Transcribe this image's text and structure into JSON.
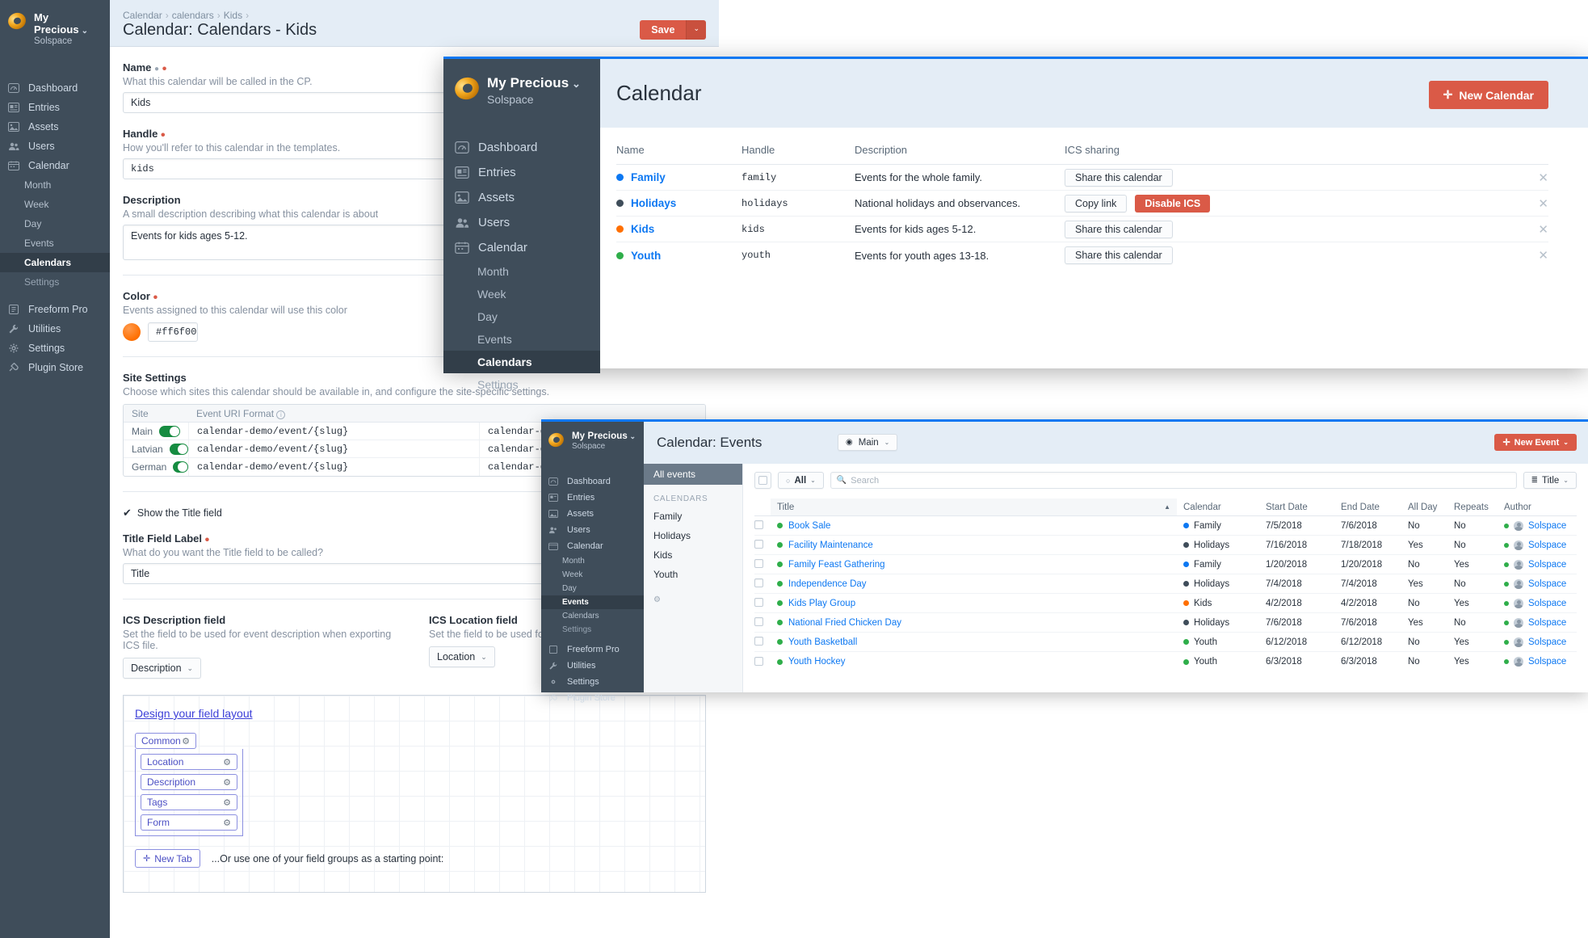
{
  "app": {
    "brand_title": "My Precious",
    "brand_sub": "Solspace"
  },
  "sidebar": {
    "items": [
      {
        "label": "Dashboard",
        "icon": "dashboard-icon"
      },
      {
        "label": "Entries",
        "icon": "entries-icon"
      },
      {
        "label": "Assets",
        "icon": "assets-icon"
      },
      {
        "label": "Users",
        "icon": "users-icon"
      },
      {
        "label": "Calendar",
        "icon": "calendar-icon"
      }
    ],
    "calendar_children": [
      "Month",
      "Week",
      "Day",
      "Events",
      "Calendars",
      "Settings"
    ],
    "active_child": "Calendars",
    "footer_items": [
      {
        "label": "Freeform Pro",
        "icon": "freeform-icon"
      },
      {
        "label": "Utilities",
        "icon": "wrench-icon"
      },
      {
        "label": "Settings",
        "icon": "gear-icon"
      },
      {
        "label": "Plugin Store",
        "icon": "plug-icon"
      }
    ]
  },
  "calendar_edit": {
    "breadcrumb": [
      "Calendar",
      "calendars",
      "Kids"
    ],
    "title": "Calendar: Calendars - Kids",
    "save_label": "Save",
    "fields": {
      "name": {
        "label": "Name",
        "instructions": "What this calendar will be called in the CP.",
        "value": "Kids"
      },
      "handle": {
        "label": "Handle",
        "instructions": "How you'll refer to this calendar in the templates.",
        "value": "kids"
      },
      "description": {
        "label": "Description",
        "instructions": "A small description describing what this calendar is about",
        "value": "Events for kids ages 5-12."
      },
      "color": {
        "label": "Color",
        "instructions": "Events assigned to this calendar will use this color",
        "value": "#ff6f00"
      },
      "site_settings": {
        "label": "Site Settings",
        "instructions": "Choose which sites this calendar should be available in, and configure the site-specific settings.",
        "columns": [
          "Site",
          "Event URI Format"
        ],
        "rows": [
          {
            "site": "Main",
            "enabled": true,
            "uri": "calendar-demo/event/{slug}",
            "template": "calendar-demo/event"
          },
          {
            "site": "Latvian",
            "enabled": true,
            "uri": "calendar-demo/event/{slug}",
            "template": "calendar-demo/event"
          },
          {
            "site": "German",
            "enabled": true,
            "uri": "calendar-demo/event/{slug}",
            "template": "calendar-demo/event"
          }
        ]
      },
      "show_title": {
        "label": "Show the Title field",
        "checked": true
      },
      "title_field_label": {
        "label": "Title Field Label",
        "instructions": "What do you want the Title field to be called?",
        "value": "Title"
      },
      "ics_description": {
        "label": "ICS Description field",
        "instructions": "Set the field to be used for event description when exporting ICS file.",
        "value": "Description"
      },
      "ics_location": {
        "label": "ICS Location field",
        "instructions": "Set the field to be used for event location",
        "value": "Location"
      },
      "field_layout": {
        "heading": "Design your field layout",
        "tab_name": "Common",
        "fields": [
          "Location",
          "Description",
          "Tags",
          "Form"
        ],
        "new_tab_label": "New Tab",
        "hint": "...Or use one of your field groups as a starting point:"
      }
    }
  },
  "calendars_list": {
    "title": "Calendar",
    "new_button": "New Calendar",
    "columns": [
      "Name",
      "Handle",
      "Description",
      "ICS sharing"
    ],
    "rows": [
      {
        "name": "Family",
        "color": "#0d78f2",
        "handle": "family",
        "description": "Events for the whole family.",
        "share_label": "Share this calendar",
        "copy_label": null,
        "disable_label": null
      },
      {
        "name": "Holidays",
        "color": "#3f4d5a",
        "handle": "holidays",
        "description": "National holidays and observances.",
        "share_label": null,
        "copy_label": "Copy link",
        "disable_label": "Disable ICS"
      },
      {
        "name": "Kids",
        "color": "#ff6f00",
        "handle": "kids",
        "description": "Events for kids ages 5-12.",
        "share_label": "Share this calendar",
        "copy_label": null,
        "disable_label": null
      },
      {
        "name": "Youth",
        "color": "#2fae4a",
        "handle": "youth",
        "description": "Events for youth ages 13-18.",
        "share_label": "Share this calendar",
        "copy_label": null,
        "disable_label": null
      }
    ]
  },
  "events_list": {
    "title": "Calendar: Events",
    "site_selector": "Main",
    "new_button": "New Event",
    "sidebar": {
      "all_label": "All events",
      "group_header": "CALENDARS",
      "calendars": [
        "Family",
        "Holidays",
        "Kids",
        "Youth"
      ]
    },
    "toolbar": {
      "status_filter": "All",
      "search_placeholder": "Search",
      "sort_label": "Title"
    },
    "columns": [
      "Title",
      "Calendar",
      "Start Date",
      "End Date",
      "All Day",
      "Repeats",
      "Author"
    ],
    "rows": [
      {
        "title": "Book Sale",
        "status": "#2fae4a",
        "calendar": "Family",
        "cal_color": "#0d78f2",
        "start": "7/5/2018",
        "end": "7/6/2018",
        "all_day": "No",
        "repeats": "No",
        "author": "Solspace"
      },
      {
        "title": "Facility Maintenance",
        "status": "#2fae4a",
        "calendar": "Holidays",
        "cal_color": "#3f4d5a",
        "start": "7/16/2018",
        "end": "7/18/2018",
        "all_day": "Yes",
        "repeats": "No",
        "author": "Solspace"
      },
      {
        "title": "Family Feast Gathering",
        "status": "#2fae4a",
        "calendar": "Family",
        "cal_color": "#0d78f2",
        "start": "1/20/2018",
        "end": "1/20/2018",
        "all_day": "No",
        "repeats": "Yes",
        "author": "Solspace"
      },
      {
        "title": "Independence Day",
        "status": "#2fae4a",
        "calendar": "Holidays",
        "cal_color": "#3f4d5a",
        "start": "7/4/2018",
        "end": "7/4/2018",
        "all_day": "Yes",
        "repeats": "No",
        "author": "Solspace"
      },
      {
        "title": "Kids Play Group",
        "status": "#2fae4a",
        "calendar": "Kids",
        "cal_color": "#ff6f00",
        "start": "4/2/2018",
        "end": "4/2/2018",
        "all_day": "No",
        "repeats": "Yes",
        "author": "Solspace"
      },
      {
        "title": "National Fried Chicken Day",
        "status": "#2fae4a",
        "calendar": "Holidays",
        "cal_color": "#3f4d5a",
        "start": "7/6/2018",
        "end": "7/6/2018",
        "all_day": "Yes",
        "repeats": "No",
        "author": "Solspace"
      },
      {
        "title": "Youth Basketball",
        "status": "#2fae4a",
        "calendar": "Youth",
        "cal_color": "#2fae4a",
        "start": "6/12/2018",
        "end": "6/12/2018",
        "all_day": "No",
        "repeats": "Yes",
        "author": "Solspace"
      },
      {
        "title": "Youth Hockey",
        "status": "#2fae4a",
        "calendar": "Youth",
        "cal_color": "#2fae4a",
        "start": "6/3/2018",
        "end": "6/3/2018",
        "all_day": "No",
        "repeats": "Yes",
        "author": "Solspace"
      }
    ]
  }
}
